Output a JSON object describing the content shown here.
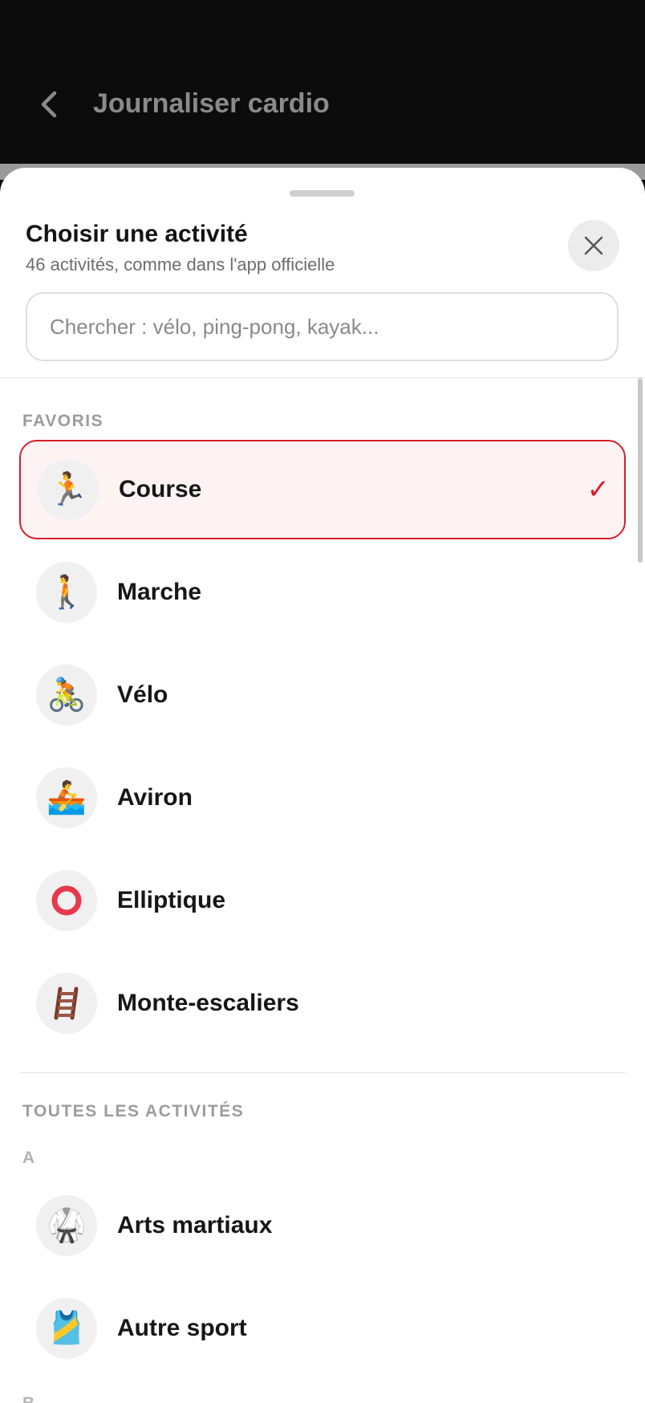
{
  "header": {
    "title": "Journaliser cardio"
  },
  "sheet": {
    "title": "Choisir une activité",
    "subtitle": "46 activités, comme dans l'app officielle",
    "search_placeholder": "Chercher : vélo, ping-pong, kayak..."
  },
  "favorites": {
    "header": "FAVORIS",
    "items": [
      {
        "label": "Course",
        "icon": "running-icon",
        "glyph": "🏃",
        "selected": true
      },
      {
        "label": "Marche",
        "icon": "walking-icon",
        "glyph": "🚶",
        "selected": false
      },
      {
        "label": "Vélo",
        "icon": "cycling-icon",
        "glyph": "🚴",
        "selected": false
      },
      {
        "label": "Aviron",
        "icon": "rowing-icon",
        "glyph": "🚣",
        "selected": false
      },
      {
        "label": "Elliptique",
        "icon": "ring-icon",
        "glyph": "⭕",
        "selected": false
      },
      {
        "label": "Monte-escaliers",
        "icon": "ladder-icon",
        "glyph": "🪜",
        "selected": false
      }
    ]
  },
  "all_activities": {
    "header": "TOUTES LES ACTIVITÉS",
    "groups": [
      {
        "letter": "A",
        "items": [
          {
            "label": "Arts martiaux",
            "icon": "martial-arts-uniform-icon",
            "glyph": "🥋"
          },
          {
            "label": "Autre sport",
            "icon": "sport-jersey-icon",
            "glyph": "🎽"
          }
        ]
      },
      {
        "letter": "B",
        "items": []
      }
    ]
  },
  "check_glyph": "✓",
  "colors": {
    "accent": "#d61f2b",
    "selected_bg": "#fdf3f3",
    "topbar_bg": "#0c0c0c"
  }
}
